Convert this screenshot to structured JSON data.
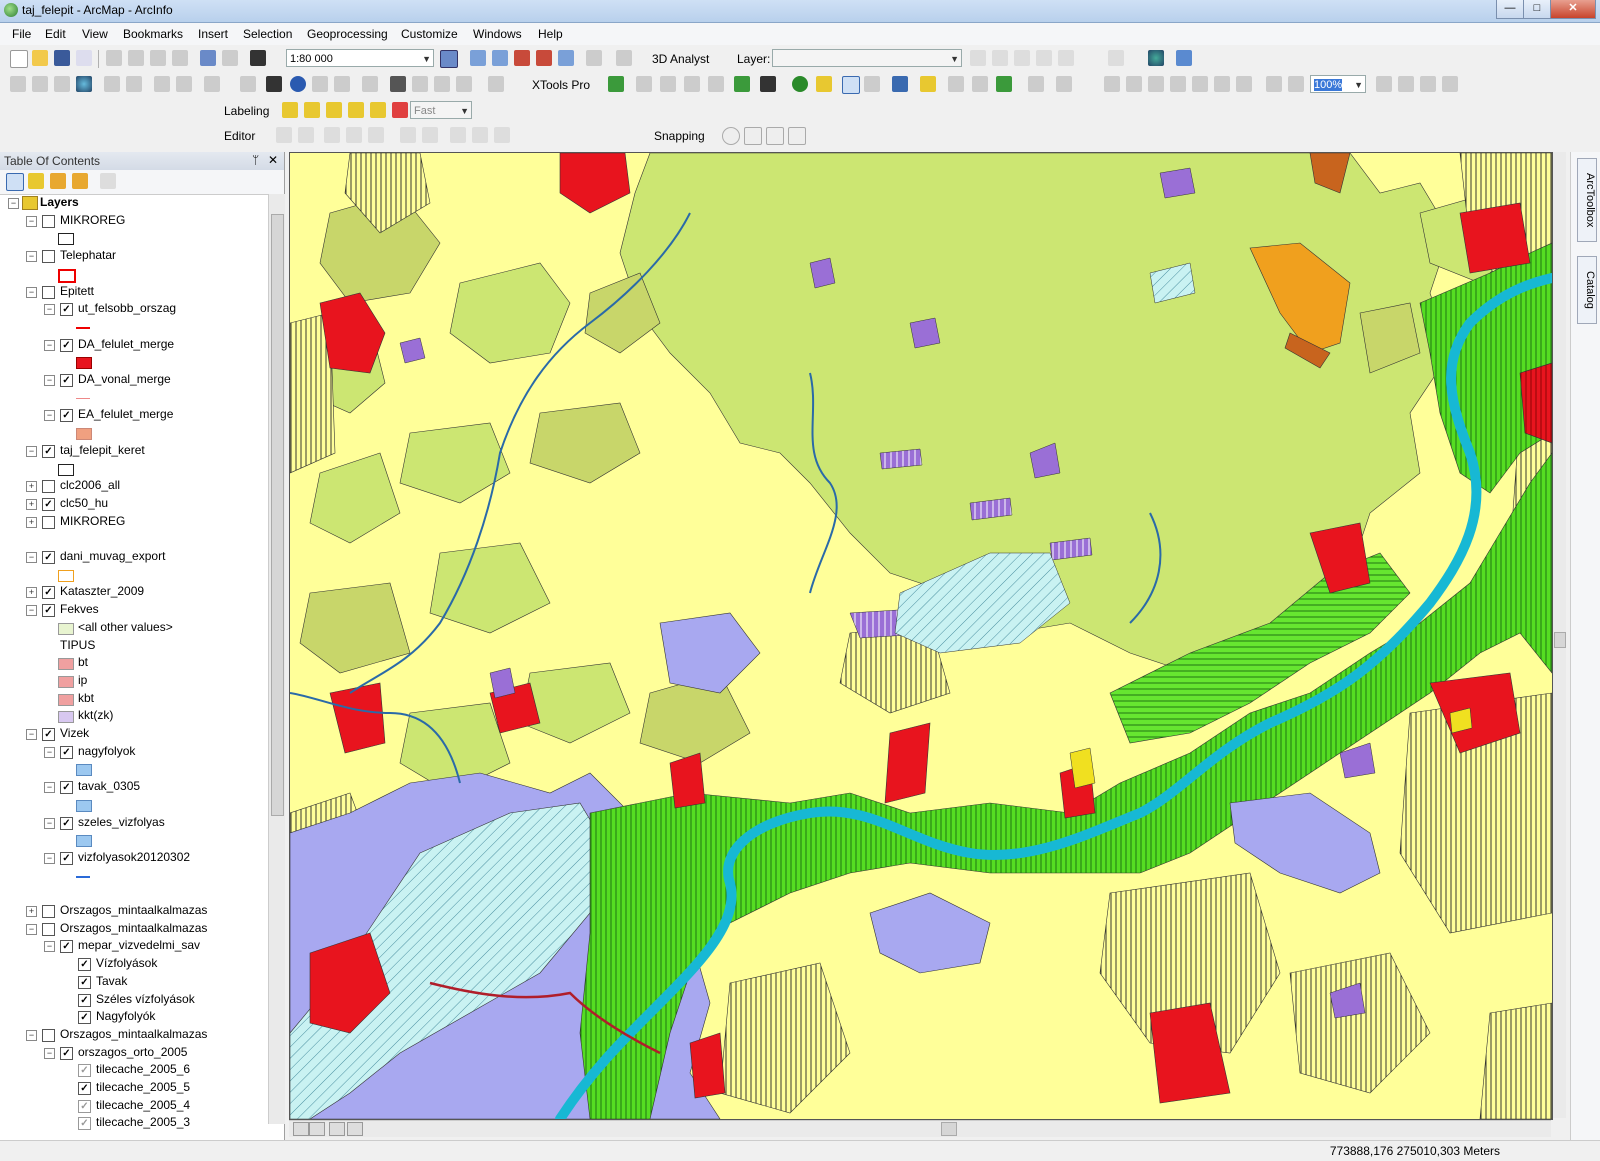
{
  "window": {
    "title": "taj_felepit - ArcMap - ArcInfo",
    "min": "—",
    "max": "□",
    "close": "✕"
  },
  "menu": [
    "File",
    "Edit",
    "View",
    "Bookmarks",
    "Insert",
    "Selection",
    "Geoprocessing",
    "Customize",
    "Windows",
    "Help"
  ],
  "toolbar": {
    "scale": "1:80 000",
    "analyst_label": "3D Analyst",
    "layer_label": "Layer:",
    "layer_value": "",
    "xtools_label": "XTools Pro",
    "zoom_pct": "100%",
    "labeling_label": "Labeling",
    "labeling_quality": "Fast",
    "editor_label": "Editor",
    "snapping_label": "Snapping"
  },
  "toc": {
    "title": "Table Of Contents",
    "pin": "ᛘ",
    "close": "✕",
    "items": [
      {
        "label": "Layers",
        "level": 0,
        "pm": "−",
        "cb": null,
        "bold": true
      },
      {
        "label": "MIKROREG",
        "level": 1,
        "pm": "−",
        "cb": false
      },
      {
        "label": "",
        "level": 2,
        "sym": "box-empty"
      },
      {
        "label": "Telephatar",
        "level": 1,
        "pm": "−",
        "cb": false
      },
      {
        "label": "",
        "level": 2,
        "sym": "box-red"
      },
      {
        "label": "Epitett",
        "level": 1,
        "pm": "−",
        "cb": false
      },
      {
        "label": "ut_felsobb_orszag",
        "level": 2,
        "pm": "−",
        "cb": true
      },
      {
        "label": "",
        "level": 3,
        "sym": "line-red"
      },
      {
        "label": "DA_felulet_merge",
        "level": 2,
        "pm": "−",
        "cb": true
      },
      {
        "label": "",
        "level": 3,
        "sym": "fill-red"
      },
      {
        "label": "DA_vonal_merge",
        "level": 2,
        "pm": "−",
        "cb": true
      },
      {
        "label": "",
        "level": 3,
        "sym": "line-pink"
      },
      {
        "label": "EA_felulet_merge",
        "level": 2,
        "pm": "−",
        "cb": true
      },
      {
        "label": "",
        "level": 3,
        "sym": "fill-salmon"
      },
      {
        "label": "taj_felepit_keret",
        "level": 1,
        "pm": "−",
        "cb": true
      },
      {
        "label": "",
        "level": 2,
        "sym": "box-empty"
      },
      {
        "label": "clc2006_all",
        "level": 1,
        "pm": "+",
        "cb": false
      },
      {
        "label": "clc50_hu",
        "level": 1,
        "pm": "+",
        "cb": true
      },
      {
        "label": "MIKROREG",
        "level": 1,
        "pm": "+",
        "cb": false
      },
      {
        "label": "",
        "level": 1,
        "spacer": true
      },
      {
        "label": "dani_muvag_export",
        "level": 1,
        "pm": "−",
        "cb": true
      },
      {
        "label": "",
        "level": 2,
        "sym": "box-orange"
      },
      {
        "label": "Kataszter_2009",
        "level": 1,
        "pm": "+",
        "cb": true
      },
      {
        "label": "Fekves",
        "level": 1,
        "pm": "−",
        "cb": true
      },
      {
        "label": "<all other values>",
        "level": 2,
        "sym": "fill-lightgreen"
      },
      {
        "label": "TIPUS",
        "level": 2,
        "sym": null
      },
      {
        "label": "bt",
        "level": 2,
        "sym": "fill-pink"
      },
      {
        "label": "ip",
        "level": 2,
        "sym": "fill-pink"
      },
      {
        "label": "kbt",
        "level": 2,
        "sym": "fill-pink"
      },
      {
        "label": "kkt(zk)",
        "level": 2,
        "sym": "fill-lavender"
      },
      {
        "label": "Vizek",
        "level": 1,
        "pm": "−",
        "cb": true
      },
      {
        "label": "nagyfolyok",
        "level": 2,
        "pm": "−",
        "cb": true
      },
      {
        "label": "",
        "level": 3,
        "sym": "fill-lightblue"
      },
      {
        "label": "tavak_0305",
        "level": 2,
        "pm": "−",
        "cb": true
      },
      {
        "label": "",
        "level": 3,
        "sym": "fill-lightblue"
      },
      {
        "label": "szeles_vizfolyas",
        "level": 2,
        "pm": "−",
        "cb": true
      },
      {
        "label": "",
        "level": 3,
        "sym": "fill-lightblue"
      },
      {
        "label": "vizfolyasok20120302",
        "level": 2,
        "pm": "−",
        "cb": true
      },
      {
        "label": "",
        "level": 3,
        "sym": "line-blue"
      },
      {
        "label": "",
        "level": 1,
        "spacer": true
      },
      {
        "label": "Orszagos_mintaalkalmazas",
        "level": 1,
        "pm": "+",
        "cb": false
      },
      {
        "label": "Orszagos_mintaalkalmazas",
        "level": 1,
        "pm": "−",
        "cb": false
      },
      {
        "label": "mepar_vizvedelmi_sav",
        "level": 2,
        "pm": "−",
        "cb": true
      },
      {
        "label": "Vízfolyások",
        "level": 3,
        "cb": true
      },
      {
        "label": "Tavak",
        "level": 3,
        "cb": true
      },
      {
        "label": "Széles vízfolyások",
        "level": 3,
        "cb": true
      },
      {
        "label": "Nagyfolyók",
        "level": 3,
        "cb": true
      },
      {
        "label": "Orszagos_mintaalkalmazas",
        "level": 1,
        "pm": "−",
        "cb": false
      },
      {
        "label": "orszagos_orto_2005",
        "level": 2,
        "pm": "−",
        "cb": true
      },
      {
        "label": "tilecache_2005_6",
        "level": 3,
        "cb": "grey"
      },
      {
        "label": "tilecache_2005_5",
        "level": 3,
        "cb": true
      },
      {
        "label": "tilecache_2005_4",
        "level": 3,
        "cb": "grey"
      },
      {
        "label": "tilecache_2005_3",
        "level": 3,
        "cb": "grey"
      }
    ]
  },
  "dock": {
    "arctoolbox": "ArcToolbox",
    "catalog": "Catalog"
  },
  "status": {
    "coords": "773888,176  275010,303 Meters"
  },
  "colors": {
    "map_bg": "#ffff99",
    "forest": "#cce672",
    "olive": "#c8d66a",
    "urban": "#e8141e",
    "purple": "#9a6fd6",
    "water": "#17b8d4",
    "bright_green": "#55dd22",
    "orange": "#f0a01e",
    "light_lavender": "#a8a8f0"
  }
}
